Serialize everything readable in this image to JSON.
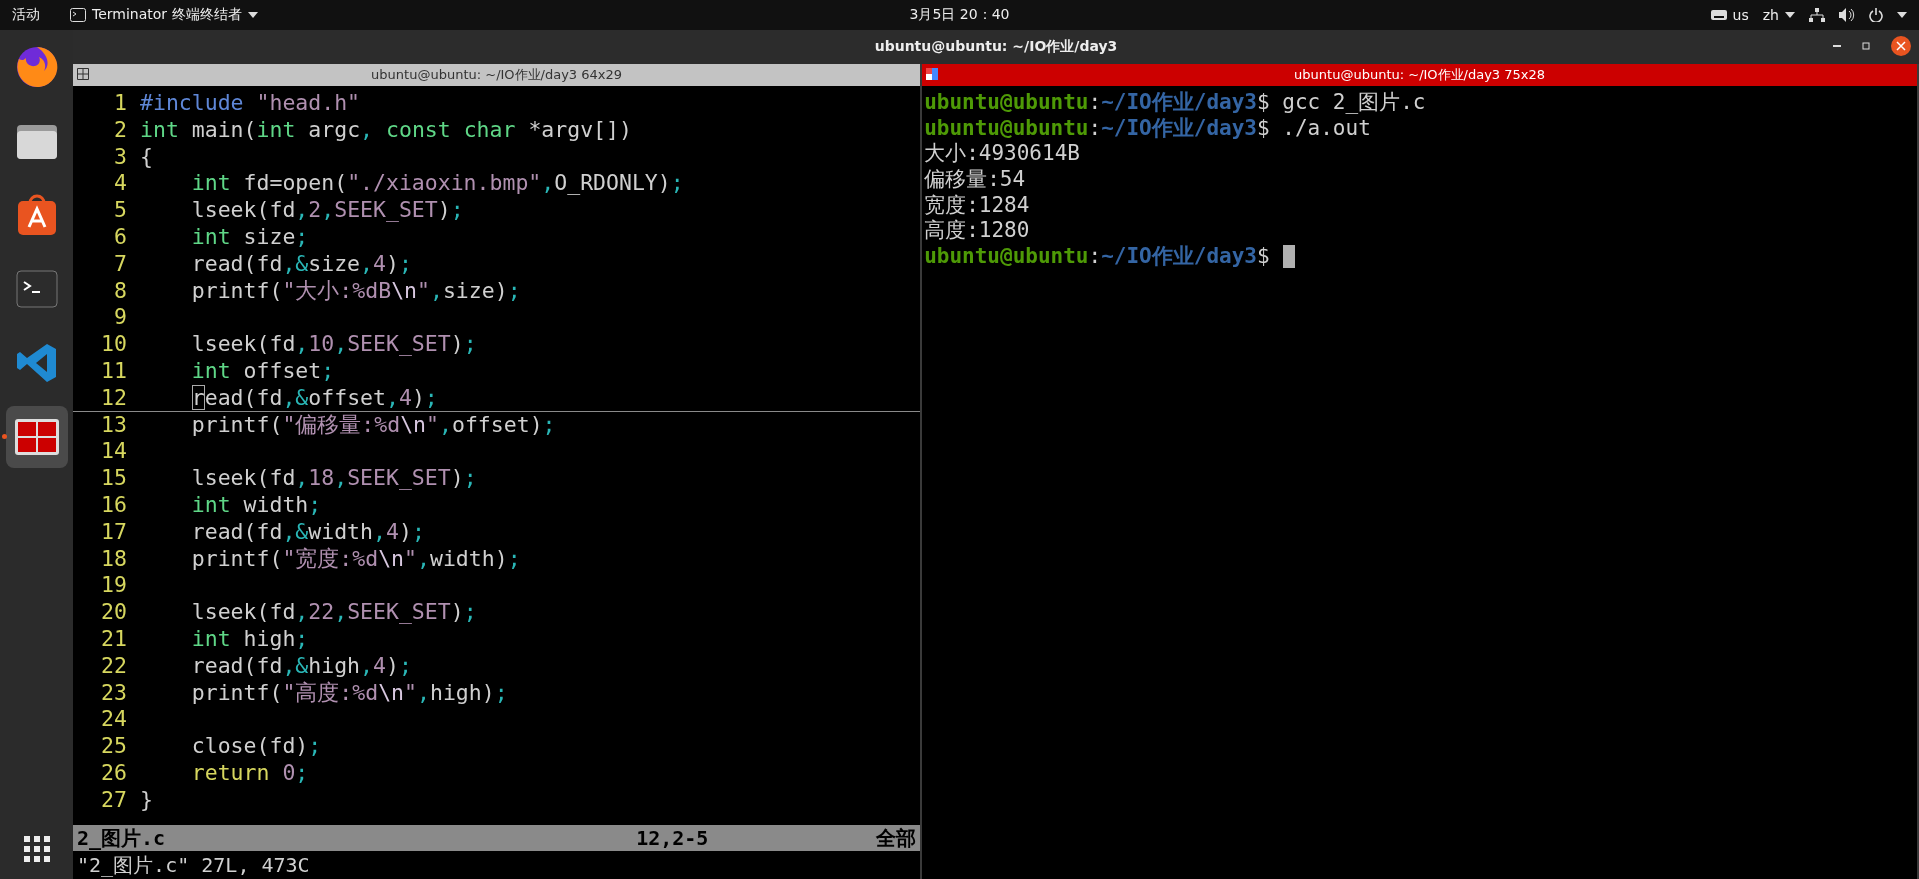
{
  "top_bar": {
    "activities": "活动",
    "app_menu": "Terminator 终端终结者",
    "clock": "3月5日  20：40",
    "keyboard": "us",
    "input_method": "zh"
  },
  "dock": {
    "items": [
      {
        "kind": "firefox",
        "selected": false
      },
      {
        "kind": "files",
        "selected": false
      },
      {
        "kind": "store",
        "selected": false
      },
      {
        "kind": "terminal",
        "selected": false
      },
      {
        "kind": "vscode",
        "selected": false
      },
      {
        "kind": "terminator",
        "selected": true
      }
    ]
  },
  "window": {
    "title": "ubuntu@ubuntu: ~/IO作业/day3"
  },
  "panes": [
    {
      "kind": "editor",
      "title": "ubuntu@ubuntu: ~/IO作业/day3 64x29",
      "selected": false,
      "lines": [
        {
          "number": "1",
          "current": false,
          "indented": false,
          "tokens": [
            {
              "kind": "pre",
              "text": "#include "
            },
            {
              "kind": "string",
              "text": "\"head.h\""
            }
          ]
        },
        {
          "number": "2",
          "current": false,
          "indented": false,
          "tokens": [
            {
              "kind": "type",
              "text": "int"
            },
            {
              "kind": "text",
              "text": " main("
            },
            {
              "kind": "type",
              "text": "int"
            },
            {
              "kind": "text",
              "text": " argc"
            },
            {
              "kind": "sep",
              "text": ","
            },
            {
              "kind": "type",
              "text": " const char"
            },
            {
              "kind": "text",
              "text": " *argv[])"
            }
          ]
        },
        {
          "number": "3",
          "current": false,
          "indented": false,
          "tokens": [
            {
              "kind": "text",
              "text": "{"
            }
          ]
        },
        {
          "number": "4",
          "current": false,
          "indented": true,
          "tokens": [
            {
              "kind": "type",
              "text": "int"
            },
            {
              "kind": "text",
              "text": " fd=open("
            },
            {
              "kind": "string",
              "text": "\"./xiaoxin.bmp\""
            },
            {
              "kind": "sep",
              "text": ","
            },
            {
              "kind": "text",
              "text": "O_RDONLY)"
            },
            {
              "kind": "sep",
              "text": ";"
            }
          ]
        },
        {
          "number": "5",
          "current": false,
          "indented": true,
          "tokens": [
            {
              "kind": "text",
              "text": "lseek(fd"
            },
            {
              "kind": "sep",
              "text": ","
            },
            {
              "kind": "const",
              "text": "2"
            },
            {
              "kind": "sep",
              "text": ","
            },
            {
              "kind": "const",
              "text": "SEEK_SET"
            },
            {
              "kind": "text",
              "text": ")"
            },
            {
              "kind": "sep",
              "text": ";"
            }
          ]
        },
        {
          "number": "6",
          "current": false,
          "indented": true,
          "tokens": [
            {
              "kind": "type",
              "text": "int"
            },
            {
              "kind": "text",
              "text": " size"
            },
            {
              "kind": "sep",
              "text": ";"
            }
          ]
        },
        {
          "number": "7",
          "current": false,
          "indented": true,
          "tokens": [
            {
              "kind": "text",
              "text": "read(fd"
            },
            {
              "kind": "sep",
              "text": ",&"
            },
            {
              "kind": "text",
              "text": "size"
            },
            {
              "kind": "sep",
              "text": ","
            },
            {
              "kind": "const",
              "text": "4"
            },
            {
              "kind": "text",
              "text": ")"
            },
            {
              "kind": "sep",
              "text": ";"
            }
          ]
        },
        {
          "number": "8",
          "current": false,
          "indented": true,
          "tokens": [
            {
              "kind": "text",
              "text": "printf("
            },
            {
              "kind": "string",
              "text": "\"大小:%dB"
            },
            {
              "kind": "escape",
              "text": "\\n"
            },
            {
              "kind": "string",
              "text": "\""
            },
            {
              "kind": "sep",
              "text": ","
            },
            {
              "kind": "text",
              "text": "size)"
            },
            {
              "kind": "sep",
              "text": ";"
            }
          ]
        },
        {
          "number": "9",
          "current": false
        },
        {
          "number": "10",
          "current": false,
          "indented": true,
          "tokens": [
            {
              "kind": "text",
              "text": "lseek(fd"
            },
            {
              "kind": "sep",
              "text": ","
            },
            {
              "kind": "const",
              "text": "10"
            },
            {
              "kind": "sep",
              "text": ","
            },
            {
              "kind": "const",
              "text": "SEEK_SET"
            },
            {
              "kind": "text",
              "text": ")"
            },
            {
              "kind": "sep",
              "text": ";"
            }
          ]
        },
        {
          "number": "11",
          "current": false,
          "indented": true,
          "tokens": [
            {
              "kind": "type",
              "text": "int"
            },
            {
              "kind": "text",
              "text": " offset"
            },
            {
              "kind": "sep",
              "text": ";"
            }
          ]
        },
        {
          "number": "12",
          "current": true,
          "indented": true,
          "tokens": [
            {
              "kind": "cursor",
              "text": "r"
            },
            {
              "kind": "text",
              "text": "ead(fd"
            },
            {
              "kind": "sep",
              "text": ",&"
            },
            {
              "kind": "text",
              "text": "offset"
            },
            {
              "kind": "sep",
              "text": ","
            },
            {
              "kind": "const",
              "text": "4"
            },
            {
              "kind": "text",
              "text": ")"
            },
            {
              "kind": "sep",
              "text": ";"
            }
          ]
        },
        {
          "number": "13",
          "current": false,
          "indented": true,
          "tokens": [
            {
              "kind": "text",
              "text": "printf("
            },
            {
              "kind": "string",
              "text": "\"偏移量:%d"
            },
            {
              "kind": "escape",
              "text": "\\n"
            },
            {
              "kind": "string",
              "text": "\""
            },
            {
              "kind": "sep",
              "text": ","
            },
            {
              "kind": "text",
              "text": "offset)"
            },
            {
              "kind": "sep",
              "text": ";"
            }
          ]
        },
        {
          "number": "14",
          "current": false
        },
        {
          "number": "15",
          "current": false,
          "indented": true,
          "tokens": [
            {
              "kind": "text",
              "text": "lseek(fd"
            },
            {
              "kind": "sep",
              "text": ","
            },
            {
              "kind": "const",
              "text": "18"
            },
            {
              "kind": "sep",
              "text": ","
            },
            {
              "kind": "const",
              "text": "SEEK_SET"
            },
            {
              "kind": "text",
              "text": ")"
            },
            {
              "kind": "sep",
              "text": ";"
            }
          ]
        },
        {
          "number": "16",
          "current": false,
          "indented": true,
          "tokens": [
            {
              "kind": "type",
              "text": "int"
            },
            {
              "kind": "text",
              "text": " width"
            },
            {
              "kind": "sep",
              "text": ";"
            }
          ]
        },
        {
          "number": "17",
          "current": false,
          "indented": true,
          "tokens": [
            {
              "kind": "text",
              "text": "read(fd"
            },
            {
              "kind": "sep",
              "text": ",&"
            },
            {
              "kind": "text",
              "text": "width"
            },
            {
              "kind": "sep",
              "text": ","
            },
            {
              "kind": "const",
              "text": "4"
            },
            {
              "kind": "text",
              "text": ")"
            },
            {
              "kind": "sep",
              "text": ";"
            }
          ]
        },
        {
          "number": "18",
          "current": false,
          "indented": true,
          "tokens": [
            {
              "kind": "text",
              "text": "printf("
            },
            {
              "kind": "string",
              "text": "\"宽度:%d"
            },
            {
              "kind": "escape",
              "text": "\\n"
            },
            {
              "kind": "string",
              "text": "\""
            },
            {
              "kind": "sep",
              "text": ","
            },
            {
              "kind": "text",
              "text": "width)"
            },
            {
              "kind": "sep",
              "text": ";"
            }
          ]
        },
        {
          "number": "19",
          "current": false
        },
        {
          "number": "20",
          "current": false,
          "indented": true,
          "tokens": [
            {
              "kind": "text",
              "text": "lseek(fd"
            },
            {
              "kind": "sep",
              "text": ","
            },
            {
              "kind": "const",
              "text": "22"
            },
            {
              "kind": "sep",
              "text": ","
            },
            {
              "kind": "const",
              "text": "SEEK_SET"
            },
            {
              "kind": "text",
              "text": ")"
            },
            {
              "kind": "sep",
              "text": ";"
            }
          ]
        },
        {
          "number": "21",
          "current": false,
          "indented": true,
          "tokens": [
            {
              "kind": "type",
              "text": "int"
            },
            {
              "kind": "text",
              "text": " high"
            },
            {
              "kind": "sep",
              "text": ";"
            }
          ]
        },
        {
          "number": "22",
          "current": false,
          "indented": true,
          "tokens": [
            {
              "kind": "text",
              "text": "read(fd"
            },
            {
              "kind": "sep",
              "text": ",&"
            },
            {
              "kind": "text",
              "text": "high"
            },
            {
              "kind": "sep",
              "text": ","
            },
            {
              "kind": "const",
              "text": "4"
            },
            {
              "kind": "text",
              "text": ")"
            },
            {
              "kind": "sep",
              "text": ";"
            }
          ]
        },
        {
          "number": "23",
          "current": false,
          "indented": true,
          "tokens": [
            {
              "kind": "text",
              "text": "printf("
            },
            {
              "kind": "string",
              "text": "\"高度:%d"
            },
            {
              "kind": "escape",
              "text": "\\n"
            },
            {
              "kind": "string",
              "text": "\""
            },
            {
              "kind": "sep",
              "text": ","
            },
            {
              "kind": "text",
              "text": "high)"
            },
            {
              "kind": "sep",
              "text": ";"
            }
          ]
        },
        {
          "number": "24",
          "current": false
        },
        {
          "number": "25",
          "current": false,
          "indented": true,
          "tokens": [
            {
              "kind": "text",
              "text": "close(fd)"
            },
            {
              "kind": "sep",
              "text": ";"
            }
          ]
        },
        {
          "number": "26",
          "current": false,
          "indented": true,
          "tokens": [
            {
              "kind": "kw",
              "text": "return"
            },
            {
              "kind": "const",
              "text": " 0"
            },
            {
              "kind": "sep",
              "text": ";"
            }
          ]
        },
        {
          "number": "27",
          "current": false,
          "indented": false,
          "tokens": [
            {
              "kind": "text",
              "text": "}"
            }
          ]
        }
      ],
      "status_line": {
        "file": "2_图片.c",
        "position": "12,2-5",
        "scroll": "全部"
      },
      "message": "\"2_图片.c\" 27L, 473C"
    },
    {
      "kind": "shell",
      "title": "ubuntu@ubuntu: ~/IO作业/day3 75x28",
      "selected": true,
      "lines": [
        {
          "kind": "prompt",
          "user": "ubuntu@ubuntu",
          "colon": ":",
          "path": "~/IO作业/day3",
          "sign": "$",
          "command": "gcc 2_图片.c"
        },
        {
          "kind": "prompt",
          "user": "ubuntu@ubuntu",
          "colon": ":",
          "path": "~/IO作业/day3",
          "sign": "$",
          "command": "./a.out"
        },
        {
          "kind": "output",
          "text": "大小:4930614B"
        },
        {
          "kind": "output",
          "text": "偏移量:54"
        },
        {
          "kind": "output",
          "text": "宽度:1284"
        },
        {
          "kind": "output",
          "text": "高度:1280"
        },
        {
          "kind": "prompt",
          "user": "ubuntu@ubuntu",
          "colon": ":",
          "path": "~/IO作业/day3",
          "sign": "$",
          "cursor": true
        }
      ]
    }
  ]
}
